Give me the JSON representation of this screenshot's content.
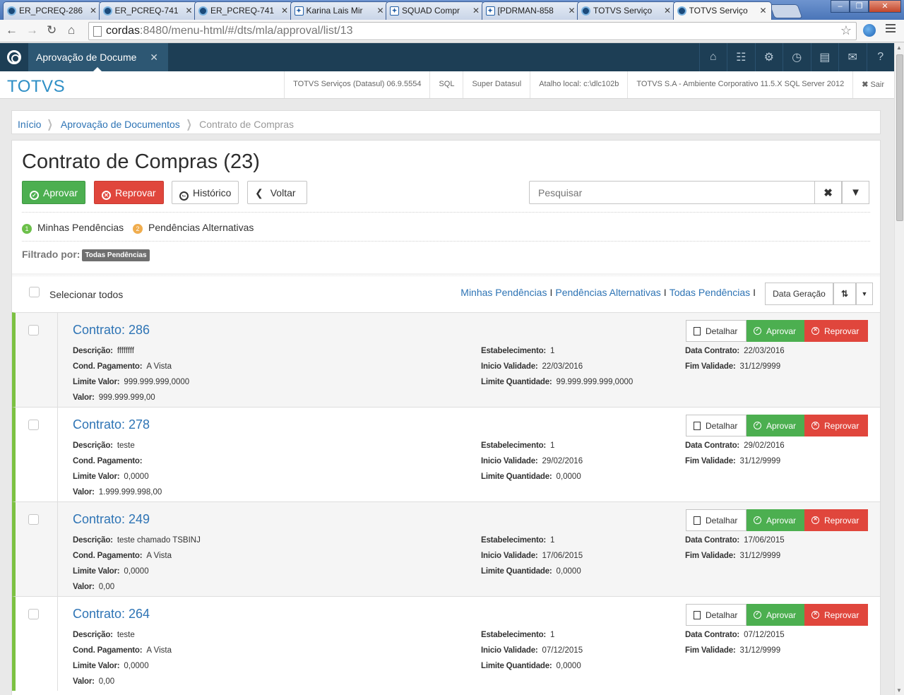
{
  "browser": {
    "tabs": [
      {
        "label": "ER_PCREQ-286",
        "icon": "totvs-icon"
      },
      {
        "label": "ER_PCREQ-741",
        "icon": "totvs-icon"
      },
      {
        "label": "ER_PCREQ-741",
        "icon": "totvs-icon"
      },
      {
        "label": "Karina Lais Mir",
        "icon": "jira-icon"
      },
      {
        "label": "SQUAD Compr",
        "icon": "jira-icon"
      },
      {
        "label": "[PDRMAN-858",
        "icon": "jira-icon"
      },
      {
        "label": "TOTVS Serviço",
        "icon": "totvs-icon"
      },
      {
        "label": "TOTVS Serviço",
        "icon": "totvs-icon",
        "active": true
      }
    ],
    "url_host": "cordas",
    "url_path": ":8480/menu-html/#/dts/mla/approval/list/13"
  },
  "app": {
    "tab_label": "Aprovação de Docume",
    "brand": "TOTVS",
    "header_icons": [
      "home-icon",
      "sitemap-icon",
      "gear-icon",
      "clock-icon",
      "document-icon",
      "envelope-icon",
      "help-icon"
    ],
    "info": [
      "TOTVS Serviços (Datasul) 06.9.5554",
      "SQL",
      "Super Datasul",
      "Atalho local: c:\\dlc102b",
      "TOTVS S.A - Ambiente Corporativo 11.5.X SQL Server 2012"
    ],
    "logout": "Sair"
  },
  "breadcrumb": {
    "home": "Início",
    "parent": "Aprovação de Documentos",
    "current": "Contrato de Compras"
  },
  "page": {
    "title": "Contrato de Compras (23)",
    "buttons": {
      "approve": "Aprovar",
      "reject": "Reprovar",
      "history": "Histórico",
      "back": "Voltar"
    },
    "search_placeholder": "Pesquisar",
    "legend": [
      {
        "num": "1",
        "label": "Minhas Pendências",
        "color": "#6cc04a"
      },
      {
        "num": "2",
        "label": "Pendências Alternativas",
        "color": "#f0ad4e"
      }
    ],
    "filter_label": "Filtrado por:",
    "filter_badge": "Todas Pendências",
    "select_all": "Selecionar todos",
    "links": [
      "Minhas Pendências",
      "Pendências Alternativas",
      "Todas Pendências"
    ],
    "sort_label": "Data Geração"
  },
  "labels": {
    "descricao": "Descrição:",
    "cond": "Cond. Pagamento:",
    "limite_valor": "Limite Valor:",
    "valor": "Valor:",
    "estab": "Estabelecimento:",
    "inicio": "Inicio Validade:",
    "limite_qtd": "Limite Quantidade:",
    "data_contrato": "Data Contrato:",
    "fim": "Fim Validade:",
    "detalhar": "Detalhar",
    "aprovar": "Aprovar",
    "reprovar": "Reprovar"
  },
  "contracts": [
    {
      "title": "Contrato: 286",
      "descricao": "ffffffff",
      "cond": "A Vista",
      "limite_valor": "999.999.999,0000",
      "valor": "999.999.999,00",
      "estab": "1",
      "inicio": "22/03/2016",
      "limite_qtd": "99.999.999.999,0000",
      "data_contrato": "22/03/2016",
      "fim": "31/12/9999"
    },
    {
      "title": "Contrato: 278",
      "descricao": "teste",
      "cond": "",
      "limite_valor": "0,0000",
      "valor": "1.999.999.998,00",
      "estab": "1",
      "inicio": "29/02/2016",
      "limite_qtd": "0,0000",
      "data_contrato": "29/02/2016",
      "fim": "31/12/9999"
    },
    {
      "title": "Contrato: 249",
      "descricao": "teste chamado TSBINJ",
      "cond": "A Vista",
      "limite_valor": "0,0000",
      "valor": "0,00",
      "estab": "1",
      "inicio": "17/06/2015",
      "limite_qtd": "0,0000",
      "data_contrato": "17/06/2015",
      "fim": "31/12/9999"
    },
    {
      "title": "Contrato: 264",
      "descricao": "teste",
      "cond": "A Vista",
      "limite_valor": "0,0000",
      "valor": "0,00",
      "estab": "1",
      "inicio": "07/12/2015",
      "limite_qtd": "0,0000",
      "data_contrato": "07/12/2015",
      "fim": "31/12/9999"
    }
  ]
}
